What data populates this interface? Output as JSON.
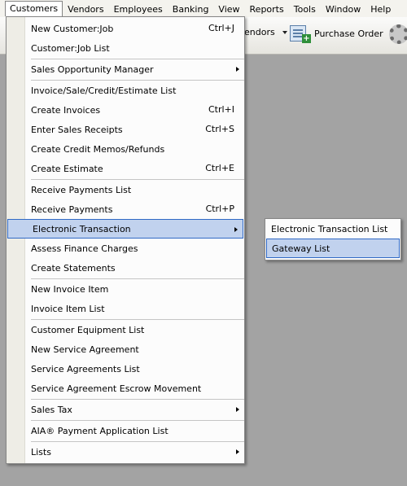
{
  "menubar": {
    "items": [
      "Customers",
      "Vendors",
      "Employees",
      "Banking",
      "View",
      "Reports",
      "Tools",
      "Window",
      "Help"
    ]
  },
  "toolbar": {
    "vendors_label": "endors",
    "purchase_order_label": "Purchase Order"
  },
  "customers_menu": {
    "items": [
      {
        "label": "New Customer:Job",
        "shortcut": "Ctrl+J"
      },
      {
        "label": "Customer:Job List",
        "shortcut": ""
      },
      {
        "label": "Sales Opportunity Manager",
        "shortcut": ""
      },
      {
        "label": "Invoice/Sale/Credit/Estimate List",
        "shortcut": ""
      },
      {
        "label": "Create Invoices",
        "shortcut": "Ctrl+I"
      },
      {
        "label": "Enter Sales Receipts",
        "shortcut": "Ctrl+S"
      },
      {
        "label": "Create Credit Memos/Refunds",
        "shortcut": ""
      },
      {
        "label": "Create Estimate",
        "shortcut": "Ctrl+E"
      },
      {
        "label": "Receive Payments List",
        "shortcut": ""
      },
      {
        "label": "Receive Payments",
        "shortcut": "Ctrl+P"
      },
      {
        "label": "Electronic Transaction",
        "shortcut": ""
      },
      {
        "label": "Assess Finance Charges",
        "shortcut": ""
      },
      {
        "label": "Create Statements",
        "shortcut": ""
      },
      {
        "label": "New Invoice Item",
        "shortcut": ""
      },
      {
        "label": "Invoice Item List",
        "shortcut": ""
      },
      {
        "label": "Customer Equipment List",
        "shortcut": ""
      },
      {
        "label": "New Service Agreement",
        "shortcut": ""
      },
      {
        "label": "Service Agreements List",
        "shortcut": ""
      },
      {
        "label": "Service Agreement Escrow Movement",
        "shortcut": ""
      },
      {
        "label": "Sales Tax",
        "shortcut": ""
      },
      {
        "label": "AIA® Payment Application List",
        "shortcut": ""
      },
      {
        "label": "Lists",
        "shortcut": ""
      }
    ]
  },
  "electronic_transaction_submenu": {
    "items": [
      "Electronic Transaction List",
      "Gateway List"
    ]
  },
  "colors": {
    "highlight": "#c1d2ee",
    "highlight_border": "#316ac5",
    "menu_gutter": "#eeede6",
    "background": "#a3a3a3"
  }
}
